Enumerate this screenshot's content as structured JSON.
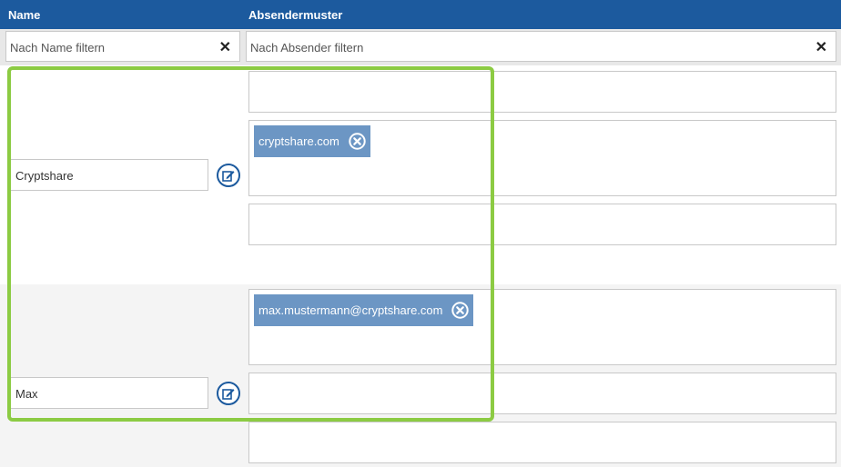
{
  "header": {
    "name_col": "Name",
    "sender_col": "Absendermuster"
  },
  "filters": {
    "name_placeholder": "Nach Name filtern",
    "sender_placeholder": "Nach Absender filtern",
    "clear_glyph": "✕"
  },
  "rows": [
    {
      "name": "Cryptshare",
      "patterns": [
        "",
        "cryptshare.com",
        ""
      ]
    },
    {
      "name": "Max",
      "patterns": [
        "max.mustermann@cryptshare.com",
        "",
        ""
      ]
    }
  ],
  "icons": {
    "edit": "edit-icon",
    "remove": "remove-circle-icon",
    "clear": "close-icon"
  },
  "colors": {
    "header": "#1c5a9e",
    "tag": "#6c96c4",
    "highlight": "#8ccb43",
    "alt_row": "#f4f4f4"
  }
}
